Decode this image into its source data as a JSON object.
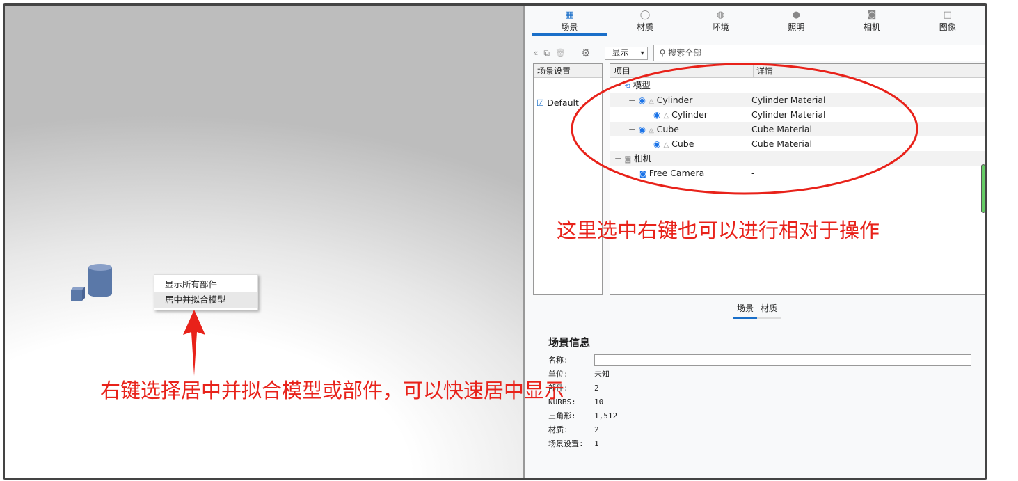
{
  "tabs": [
    {
      "label": "场景",
      "icon": "scene-list-icon"
    },
    {
      "label": "材质",
      "icon": "material-icon"
    },
    {
      "label": "环境",
      "icon": "globe-icon"
    },
    {
      "label": "照明",
      "icon": "bulb-icon"
    },
    {
      "label": "相机",
      "icon": "camera-icon"
    },
    {
      "label": "图像",
      "icon": "image-frame-icon"
    }
  ],
  "toolbar": {
    "display_select": "显示",
    "search_placeholder": "搜索全部"
  },
  "left_pane": {
    "header": "场景设置",
    "item": "Default"
  },
  "tree": {
    "col1": "项目",
    "col2": "详情",
    "rows": [
      {
        "label": "模型",
        "detail": "-"
      },
      {
        "label": "Cylinder",
        "detail": "Cylinder Material"
      },
      {
        "label": "Cylinder",
        "detail": "Cylinder Material"
      },
      {
        "label": "Cube",
        "detail": "Cube Material"
      },
      {
        "label": "Cube",
        "detail": "Cube Material"
      },
      {
        "label": "相机",
        "detail": ""
      },
      {
        "label": "Free Camera",
        "detail": "-"
      }
    ]
  },
  "subtabs": [
    "场景",
    "材质"
  ],
  "info": {
    "title": "场景信息",
    "name_label": "名称:",
    "name_value": "",
    "fields": [
      {
        "k": "单位:",
        "v": "未知"
      },
      {
        "k": "部件:",
        "v": "2"
      },
      {
        "k": "NURBS:",
        "v": "10"
      },
      {
        "k": "三角形:",
        "v": "1,512"
      },
      {
        "k": "材质:",
        "v": "2"
      },
      {
        "k": "场景设置:",
        "v": "1"
      }
    ]
  },
  "context_menu": [
    "显示所有部件",
    "居中并拟合模型"
  ],
  "annotations": {
    "right": "这里选中右键也可以进行相对于操作",
    "bottom": "右键选择居中并拟合模型或部件，可以快速居中显示"
  },
  "colors": {
    "accent": "#1a6fc9",
    "annotation": "#e8221a"
  }
}
